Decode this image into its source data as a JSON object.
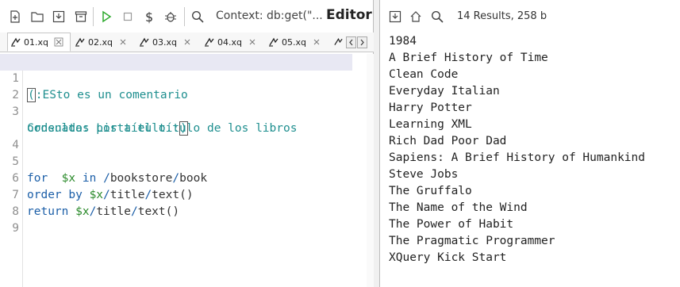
{
  "editor": {
    "context_label": "Context: db:get(\"...",
    "title": "Editor",
    "tabs": [
      {
        "label": "01.xq",
        "active": true
      },
      {
        "label": "02.xq",
        "active": false
      },
      {
        "label": "03.xq",
        "active": false
      },
      {
        "label": "04.xq",
        "active": false
      },
      {
        "label": "05.xq",
        "active": false
      }
    ],
    "line_numbers": [
      "1",
      "2",
      "3",
      "4",
      "5",
      "6",
      "7",
      "8",
      "9"
    ],
    "code": {
      "l1_open": "(",
      "l1_text": ":ESto es un comentario",
      "l3_text": "Consulta: Lista el título de los libros",
      "l3b_text": "ordenados por título.:",
      "l3b_close": ")",
      "l5_for": "for",
      "l5_var": "$x",
      "l5_in": "in",
      "l5_path_a": "/",
      "l5_bookstore": "bookstore",
      "l5_path_b": "/",
      "l5_book": "book",
      "l6_order": "order by",
      "l6_var": "$x",
      "l6_s1": "/",
      "l6_title": "title",
      "l6_s2": "/",
      "l6_text": "text()",
      "l7_return": "return",
      "l7_var": "$x",
      "l7_s1": "/",
      "l7_title": "title",
      "l7_s2": "/",
      "l7_text": "text()"
    }
  },
  "results": {
    "info": "14 Results, 258 b",
    "items": [
      "1984",
      "A Brief History of Time",
      "Clean Code",
      "Everyday Italian",
      "Harry Potter",
      "Learning XML",
      "Rich Dad Poor Dad",
      "Sapiens: A Brief History of Humankind",
      "Steve Jobs",
      "The Gruffalo",
      "The Name of the Wind",
      "The Power of Habit",
      "The Pragmatic Programmer",
      "XQuery Kick Start"
    ]
  },
  "colors": {
    "comment": "#1f8f8f",
    "keyword": "#1c5fa8",
    "variable": "#2a8a2a",
    "run_icon": "#2eaa2e"
  }
}
